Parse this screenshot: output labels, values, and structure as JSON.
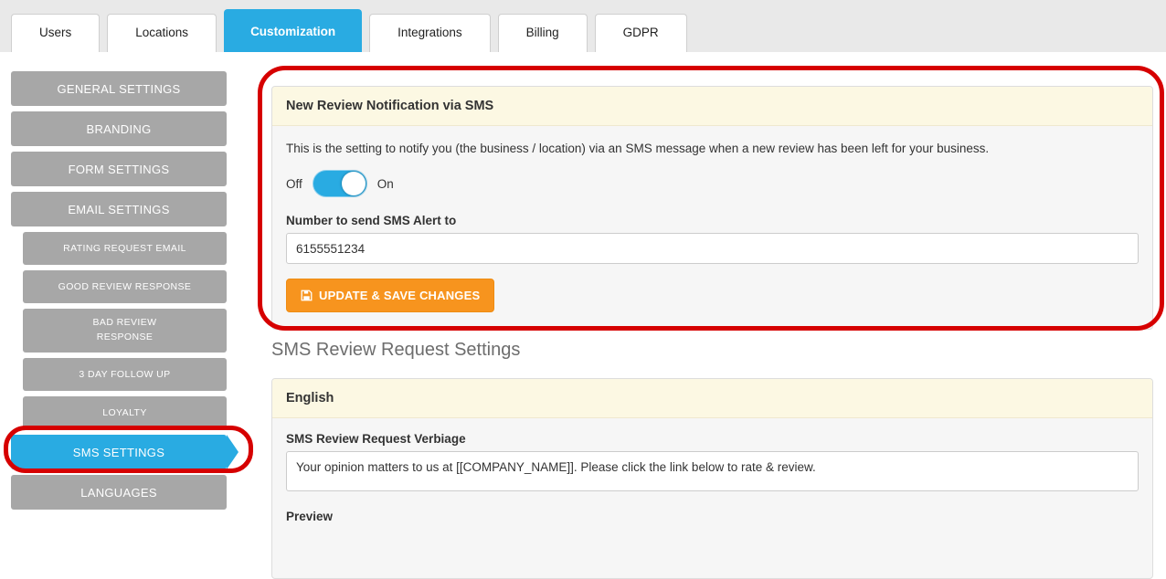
{
  "tabs": [
    {
      "label": "Users",
      "active": false
    },
    {
      "label": "Locations",
      "active": false
    },
    {
      "label": "Customization",
      "active": true
    },
    {
      "label": "Integrations",
      "active": false
    },
    {
      "label": "Billing",
      "active": false
    },
    {
      "label": "GDPR",
      "active": false
    }
  ],
  "sidebar": {
    "items": [
      {
        "label": "GENERAL SETTINGS",
        "level": 1,
        "active": false
      },
      {
        "label": "BRANDING",
        "level": 1,
        "active": false
      },
      {
        "label": "FORM SETTINGS",
        "level": 1,
        "active": false
      },
      {
        "label": "EMAIL SETTINGS",
        "level": 1,
        "active": false
      },
      {
        "label": "RATING REQUEST EMAIL",
        "level": 2,
        "active": false
      },
      {
        "label": "GOOD REVIEW RESPONSE",
        "level": 2,
        "active": false
      },
      {
        "label": "BAD REVIEW RESPONSE",
        "level": 2,
        "active": false
      },
      {
        "label": "3 DAY FOLLOW UP",
        "level": 2,
        "active": false
      },
      {
        "label": "LOYALTY",
        "level": 2,
        "active": false
      },
      {
        "label": "SMS SETTINGS",
        "level": 1,
        "active": true
      },
      {
        "label": "LANGUAGES",
        "level": 1,
        "active": false
      }
    ]
  },
  "notification_panel": {
    "title": "New Review Notification via SMS",
    "description": "This is the setting to notify you (the business / location) via an SMS message when a new review has been left for your business.",
    "toggle": {
      "off_label": "Off",
      "on_label": "On",
      "state": "on"
    },
    "phone_label": "Number to send SMS Alert to",
    "phone_value": "6155551234",
    "save_button_label": "UPDATE & SAVE CHANGES"
  },
  "request_settings": {
    "heading": "SMS Review Request Settings",
    "language_panel": {
      "title": "English",
      "verbiage_label": "SMS Review Request Verbiage",
      "verbiage_value": "Your opinion matters to us at [[COMPANY_NAME]]. Please click the link below to rate & review.",
      "preview_label": "Preview"
    }
  },
  "colors": {
    "accent_blue": "#29abe2",
    "sidebar_gray": "#a7a7a7",
    "panel_header_yellow": "#fcf8e3",
    "button_orange": "#f7941e",
    "annotation_red": "#d60000"
  }
}
